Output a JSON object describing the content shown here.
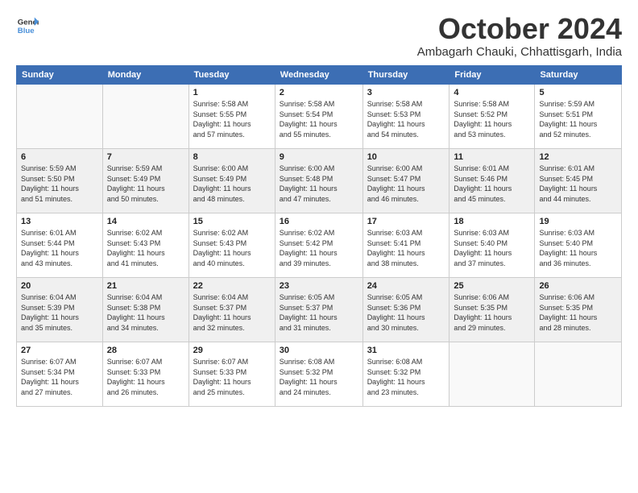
{
  "header": {
    "logo_line1": "General",
    "logo_line2": "Blue",
    "month": "October 2024",
    "location": "Ambagarh Chauki, Chhattisgarh, India"
  },
  "weekdays": [
    "Sunday",
    "Monday",
    "Tuesday",
    "Wednesday",
    "Thursday",
    "Friday",
    "Saturday"
  ],
  "weeks": [
    [
      {
        "day": "",
        "info": ""
      },
      {
        "day": "",
        "info": ""
      },
      {
        "day": "1",
        "info": "Sunrise: 5:58 AM\nSunset: 5:55 PM\nDaylight: 11 hours\nand 57 minutes."
      },
      {
        "day": "2",
        "info": "Sunrise: 5:58 AM\nSunset: 5:54 PM\nDaylight: 11 hours\nand 55 minutes."
      },
      {
        "day": "3",
        "info": "Sunrise: 5:58 AM\nSunset: 5:53 PM\nDaylight: 11 hours\nand 54 minutes."
      },
      {
        "day": "4",
        "info": "Sunrise: 5:58 AM\nSunset: 5:52 PM\nDaylight: 11 hours\nand 53 minutes."
      },
      {
        "day": "5",
        "info": "Sunrise: 5:59 AM\nSunset: 5:51 PM\nDaylight: 11 hours\nand 52 minutes."
      }
    ],
    [
      {
        "day": "6",
        "info": "Sunrise: 5:59 AM\nSunset: 5:50 PM\nDaylight: 11 hours\nand 51 minutes."
      },
      {
        "day": "7",
        "info": "Sunrise: 5:59 AM\nSunset: 5:49 PM\nDaylight: 11 hours\nand 50 minutes."
      },
      {
        "day": "8",
        "info": "Sunrise: 6:00 AM\nSunset: 5:49 PM\nDaylight: 11 hours\nand 48 minutes."
      },
      {
        "day": "9",
        "info": "Sunrise: 6:00 AM\nSunset: 5:48 PM\nDaylight: 11 hours\nand 47 minutes."
      },
      {
        "day": "10",
        "info": "Sunrise: 6:00 AM\nSunset: 5:47 PM\nDaylight: 11 hours\nand 46 minutes."
      },
      {
        "day": "11",
        "info": "Sunrise: 6:01 AM\nSunset: 5:46 PM\nDaylight: 11 hours\nand 45 minutes."
      },
      {
        "day": "12",
        "info": "Sunrise: 6:01 AM\nSunset: 5:45 PM\nDaylight: 11 hours\nand 44 minutes."
      }
    ],
    [
      {
        "day": "13",
        "info": "Sunrise: 6:01 AM\nSunset: 5:44 PM\nDaylight: 11 hours\nand 43 minutes."
      },
      {
        "day": "14",
        "info": "Sunrise: 6:02 AM\nSunset: 5:43 PM\nDaylight: 11 hours\nand 41 minutes."
      },
      {
        "day": "15",
        "info": "Sunrise: 6:02 AM\nSunset: 5:43 PM\nDaylight: 11 hours\nand 40 minutes."
      },
      {
        "day": "16",
        "info": "Sunrise: 6:02 AM\nSunset: 5:42 PM\nDaylight: 11 hours\nand 39 minutes."
      },
      {
        "day": "17",
        "info": "Sunrise: 6:03 AM\nSunset: 5:41 PM\nDaylight: 11 hours\nand 38 minutes."
      },
      {
        "day": "18",
        "info": "Sunrise: 6:03 AM\nSunset: 5:40 PM\nDaylight: 11 hours\nand 37 minutes."
      },
      {
        "day": "19",
        "info": "Sunrise: 6:03 AM\nSunset: 5:40 PM\nDaylight: 11 hours\nand 36 minutes."
      }
    ],
    [
      {
        "day": "20",
        "info": "Sunrise: 6:04 AM\nSunset: 5:39 PM\nDaylight: 11 hours\nand 35 minutes."
      },
      {
        "day": "21",
        "info": "Sunrise: 6:04 AM\nSunset: 5:38 PM\nDaylight: 11 hours\nand 34 minutes."
      },
      {
        "day": "22",
        "info": "Sunrise: 6:04 AM\nSunset: 5:37 PM\nDaylight: 11 hours\nand 32 minutes."
      },
      {
        "day": "23",
        "info": "Sunrise: 6:05 AM\nSunset: 5:37 PM\nDaylight: 11 hours\nand 31 minutes."
      },
      {
        "day": "24",
        "info": "Sunrise: 6:05 AM\nSunset: 5:36 PM\nDaylight: 11 hours\nand 30 minutes."
      },
      {
        "day": "25",
        "info": "Sunrise: 6:06 AM\nSunset: 5:35 PM\nDaylight: 11 hours\nand 29 minutes."
      },
      {
        "day": "26",
        "info": "Sunrise: 6:06 AM\nSunset: 5:35 PM\nDaylight: 11 hours\nand 28 minutes."
      }
    ],
    [
      {
        "day": "27",
        "info": "Sunrise: 6:07 AM\nSunset: 5:34 PM\nDaylight: 11 hours\nand 27 minutes."
      },
      {
        "day": "28",
        "info": "Sunrise: 6:07 AM\nSunset: 5:33 PM\nDaylight: 11 hours\nand 26 minutes."
      },
      {
        "day": "29",
        "info": "Sunrise: 6:07 AM\nSunset: 5:33 PM\nDaylight: 11 hours\nand 25 minutes."
      },
      {
        "day": "30",
        "info": "Sunrise: 6:08 AM\nSunset: 5:32 PM\nDaylight: 11 hours\nand 24 minutes."
      },
      {
        "day": "31",
        "info": "Sunrise: 6:08 AM\nSunset: 5:32 PM\nDaylight: 11 hours\nand 23 minutes."
      },
      {
        "day": "",
        "info": ""
      },
      {
        "day": "",
        "info": ""
      }
    ]
  ]
}
